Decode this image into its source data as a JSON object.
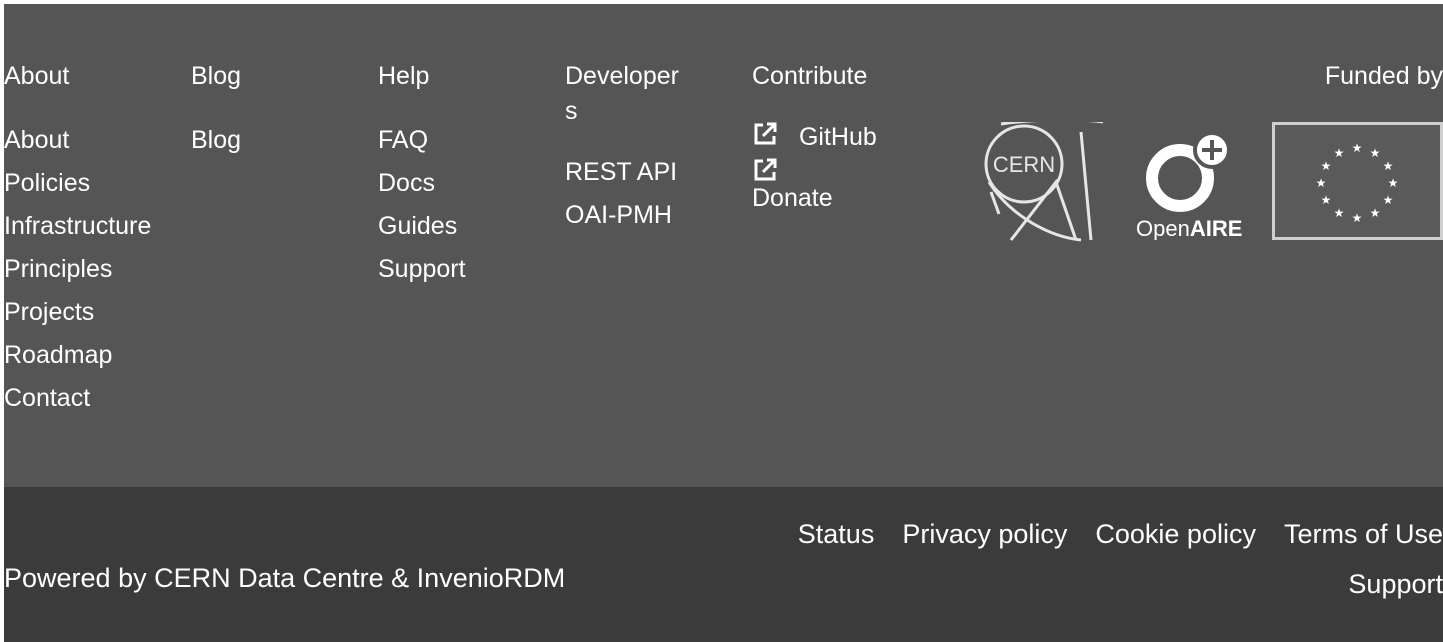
{
  "columns": {
    "about": {
      "title": "About",
      "items": [
        "About",
        "Policies",
        "Infrastructure",
        "Principles",
        "Projects",
        "Roadmap",
        "Contact"
      ]
    },
    "blog": {
      "title": "Blog",
      "items": [
        "Blog"
      ]
    },
    "help": {
      "title": "Help",
      "items": [
        "FAQ",
        "Docs",
        "Guides",
        "Support"
      ]
    },
    "developers": {
      "title": "Developers",
      "items": [
        "REST API",
        "OAI-PMH"
      ]
    },
    "contribute": {
      "title": "Contribute",
      "github": "GitHub",
      "donate": "Donate"
    }
  },
  "funded_by": "Funded by",
  "logos": {
    "cern": "CERN",
    "openaire_prefix": "Open",
    "openaire_suffix": "AIRE"
  },
  "bottom": {
    "powered": "Powered by CERN Data Centre & InvenioRDM",
    "links": [
      "Status",
      "Privacy policy",
      "Cookie policy",
      "Terms of Use"
    ],
    "support": "Support"
  },
  "colors": {
    "top": "#555555",
    "bottom": "#3b3b3b",
    "text": "#ffffff"
  },
  "icons": {
    "external": "external-link-icon"
  }
}
